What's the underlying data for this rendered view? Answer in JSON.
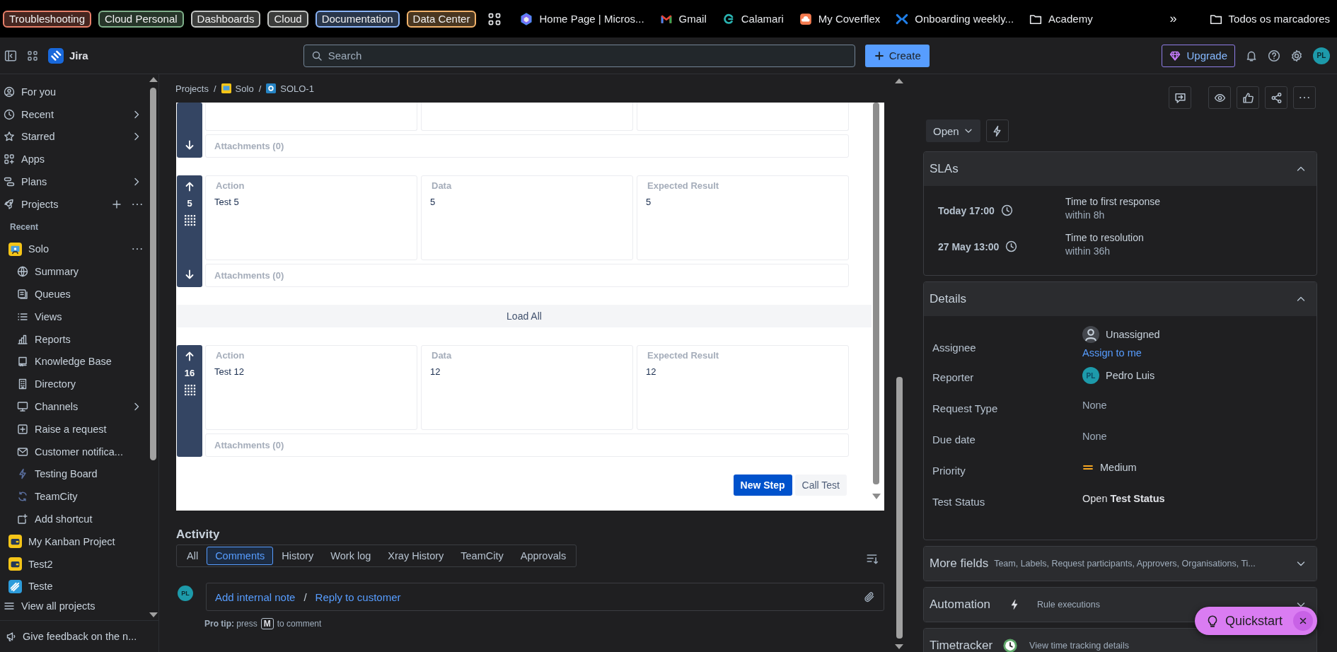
{
  "bookmarks_bar": {
    "tab_groups": [
      {
        "label": "Troubleshooting",
        "color": "#e8806a"
      },
      {
        "label": "Cloud Personal",
        "color": "#7fb08a"
      },
      {
        "label": "Dashboards",
        "color": "#c4c7c5"
      },
      {
        "label": "Cloud",
        "color": "#c4c7c5"
      },
      {
        "label": "Documentation",
        "color": "#8ab4f8"
      },
      {
        "label": "Data Center",
        "color": "#f2b36b"
      }
    ],
    "bookmarks": [
      {
        "label": "Home Page | Micros...",
        "kind": "site"
      },
      {
        "label": "Gmail",
        "kind": "site"
      },
      {
        "label": "Calamari",
        "kind": "site"
      },
      {
        "label": "My Coverflex",
        "kind": "site"
      },
      {
        "label": "Onboarding weekly...",
        "kind": "site"
      },
      {
        "label": "Academy",
        "kind": "folder"
      }
    ],
    "overflow": "»",
    "all_bookmarks": "Todos os marcadores"
  },
  "top_bar": {
    "product": "Jira",
    "search_placeholder": "Search",
    "create": "Create",
    "upgrade": "Upgrade",
    "avatar": "PL"
  },
  "sidebar": {
    "items": [
      {
        "label": "For you",
        "expandable": false,
        "has_actions": false
      },
      {
        "label": "Recent",
        "expandable": true,
        "has_actions": false
      },
      {
        "label": "Starred",
        "expandable": true,
        "has_actions": false
      },
      {
        "label": "Apps",
        "expandable": false,
        "has_actions": false
      },
      {
        "label": "Plans",
        "expandable": true,
        "has_actions": false
      },
      {
        "label": "Projects",
        "expandable": false,
        "has_actions": true
      }
    ],
    "section": "Recent",
    "projects": [
      {
        "name": "Solo",
        "color": "#f5c518",
        "has_actions": true,
        "expanded": true,
        "children": [
          {
            "label": "Summary",
            "expandable": false
          },
          {
            "label": "Queues",
            "expandable": false
          },
          {
            "label": "Views",
            "expandable": false
          },
          {
            "label": "Reports",
            "expandable": false
          },
          {
            "label": "Knowledge Base",
            "expandable": false
          },
          {
            "label": "Directory",
            "expandable": false
          },
          {
            "label": "Channels",
            "expandable": true
          },
          {
            "label": "Raise a request",
            "expandable": false
          },
          {
            "label": "Customer notifica...",
            "expandable": false
          },
          {
            "label": "Testing Board",
            "expandable": false
          },
          {
            "label": "TeamCity",
            "expandable": false
          },
          {
            "label": "Add shortcut",
            "expandable": false
          }
        ]
      },
      {
        "name": "My Kanban Project",
        "color": "#f5c518",
        "has_actions": false,
        "expanded": false
      },
      {
        "name": "Test2",
        "color": "#f5c518",
        "has_actions": false,
        "expanded": false
      },
      {
        "name": "Teste",
        "color": "#2d9cdb",
        "has_actions": false,
        "expanded": false
      }
    ],
    "view_all": "View all projects",
    "feedback": "Give feedback on the n..."
  },
  "breadcrumbs": [
    {
      "label": "Projects",
      "separator": "/"
    },
    {
      "label": "Solo",
      "separator": "/"
    },
    {
      "label": "SOLO-1"
    }
  ],
  "test_steps": {
    "rows": [
      {
        "kind": "step",
        "clipped": true,
        "move_up": false,
        "move_down": true,
        "attachments": "Attachments (0)"
      },
      {
        "kind": "step",
        "clipped": false,
        "number": "5",
        "move_up": true,
        "move_down": true,
        "fields": [
          {
            "heading": "Action",
            "value": "Test 5"
          },
          {
            "heading": "Data",
            "value": "5"
          },
          {
            "heading": "Expected Result",
            "value": "5"
          }
        ],
        "attachments": "Attachments (0)"
      },
      {
        "kind": "load_all",
        "label": "Load All"
      },
      {
        "kind": "step",
        "clipped": false,
        "number": "16",
        "move_up": true,
        "move_down": false,
        "fields": [
          {
            "heading": "Action",
            "value": "Test 12"
          },
          {
            "heading": "Data",
            "value": "12"
          },
          {
            "heading": "Expected Result",
            "value": "12"
          }
        ],
        "attachments": "Attachments (0)"
      }
    ],
    "buttons": [
      {
        "label": "New Step",
        "kind": "primary"
      },
      {
        "label": "Call Test",
        "kind": "secondary"
      }
    ]
  },
  "activity": {
    "title": "Activity",
    "tabs": [
      {
        "label": "All",
        "selected": false
      },
      {
        "label": "Comments",
        "selected": true
      },
      {
        "label": "History",
        "selected": false
      },
      {
        "label": "Work log",
        "selected": false
      },
      {
        "label": "Xray History",
        "selected": false
      },
      {
        "label": "TeamCity",
        "selected": false
      },
      {
        "label": "Approvals",
        "selected": false
      }
    ],
    "comment": {
      "avatar": "PL",
      "internal_note": "Add internal note",
      "separator": "/",
      "reply": "Reply to customer"
    },
    "pro_tip": "**Pro tip:** press",
    "pro_tip_key": "M",
    "pro_tip_end": "to comment"
  },
  "issue_side": {
    "status": "Open",
    "slas": {
      "title": "SLAs",
      "expanded": true,
      "rows": [
        {
          "time": "Today 17:00",
          "goal": "Time to first response",
          "limit": "within 8h"
        },
        {
          "time": "27 May 13:00",
          "goal": "Time to resolution",
          "limit": "within 36h"
        }
      ]
    },
    "details": {
      "title": "Details",
      "expanded": true,
      "fields": [
        {
          "label": "Assignee",
          "kind": "assignee",
          "value": "Unassigned",
          "action": "Assign to me"
        },
        {
          "label": "Reporter",
          "kind": "user",
          "avatar": "PL",
          "value": "Pedro Luis"
        },
        {
          "label": "Request Type",
          "kind": "empty",
          "value": "None"
        },
        {
          "label": "Due date",
          "kind": "empty",
          "value": "None"
        },
        {
          "label": "Priority",
          "kind": "priority",
          "value": "Medium"
        },
        {
          "label": "Test Status",
          "kind": "rich",
          "value": "Open **Test Status**"
        }
      ]
    },
    "more_fields": {
      "title": "More fields",
      "summary": "Team, Labels, Request participants, Approvers, Organisations, Ti...",
      "expanded": false
    },
    "automation": {
      "title": "Automation",
      "summary": "Rule executions",
      "expanded": false
    },
    "timetracker": {
      "title": "Timetracker",
      "summary": "View time tracking details"
    }
  },
  "quickstart": {
    "label": "Quickstart"
  }
}
